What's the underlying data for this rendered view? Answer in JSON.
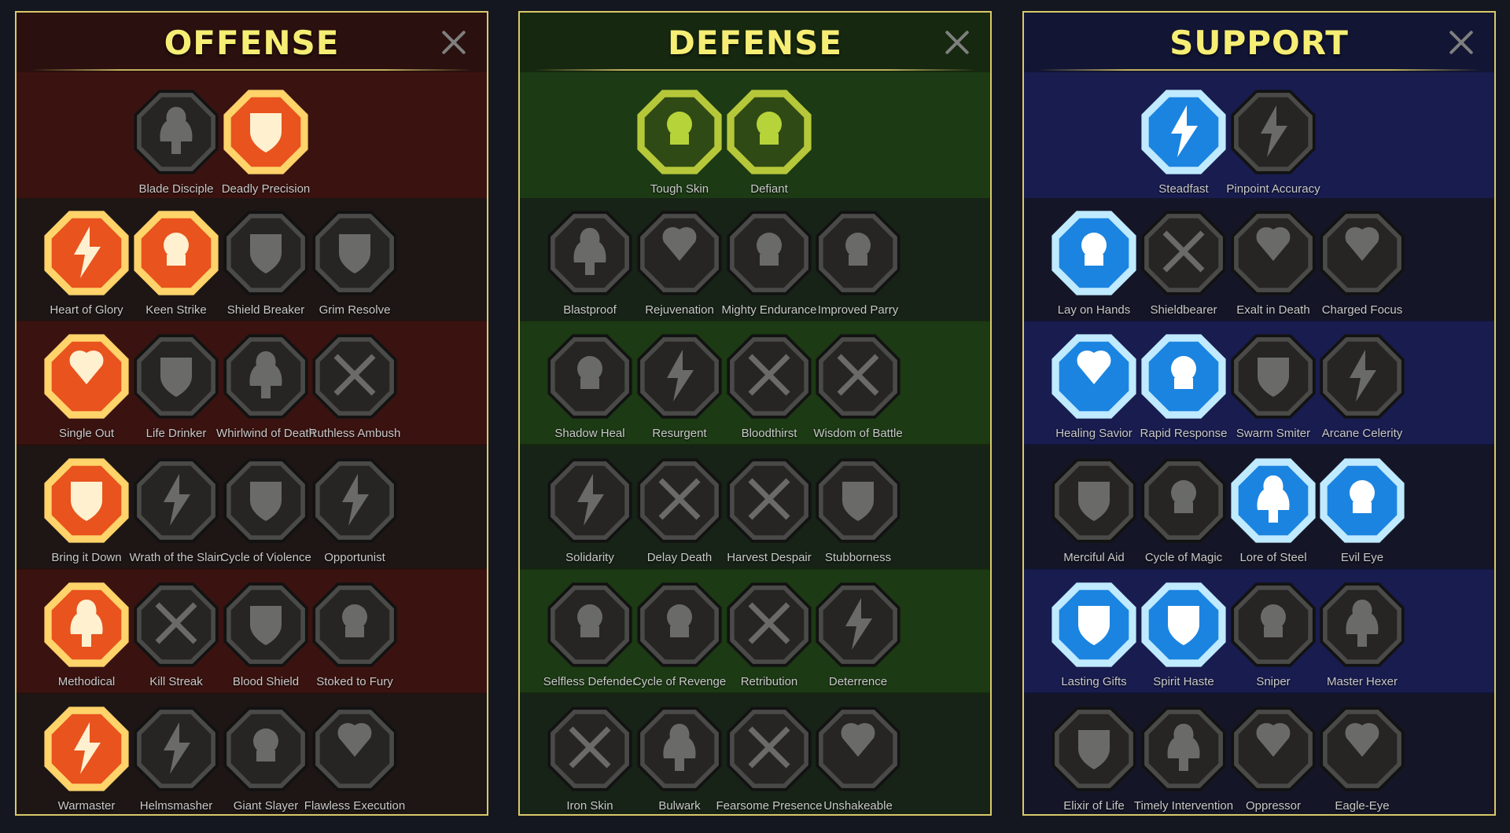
{
  "panels": [
    {
      "id": "offense",
      "title": "OFFENSE",
      "colors": {
        "active_fill": "#e8531e",
        "active_ring": "#ffd36a",
        "active_glyph": "#fff0d0"
      },
      "rows": [
        [
          {
            "label": "Blade Disciple",
            "icon": "crossed-swords-icon",
            "active": false,
            "col": 1
          },
          {
            "label": "Deadly Precision",
            "icon": "dagger-strike-icon",
            "active": true,
            "col": 2
          }
        ],
        [
          {
            "label": "Heart of Glory",
            "icon": "horned-heart-icon",
            "active": true
          },
          {
            "label": "Keen Strike",
            "icon": "sword-slash-icon",
            "active": true
          },
          {
            "label": "Shield Breaker",
            "icon": "broken-shield-icon",
            "active": false
          },
          {
            "label": "Grim Resolve",
            "icon": "dark-heart-icon",
            "active": false
          }
        ],
        [
          {
            "label": "Single Out",
            "icon": "arrows-target-icon",
            "active": true
          },
          {
            "label": "Life Drinker",
            "icon": "fangs-icon",
            "active": false
          },
          {
            "label": "Whirlwind of Death",
            "icon": "skull-whirl-icon",
            "active": false
          },
          {
            "label": "Ruthless Ambush",
            "icon": "hand-blade-icon",
            "active": false
          }
        ],
        [
          {
            "label": "Bring it Down",
            "icon": "bleeding-heart-sword-icon",
            "active": true
          },
          {
            "label": "Wrath of the Slain",
            "icon": "fist-blade-icon",
            "active": false
          },
          {
            "label": "Cycle of Violence",
            "icon": "axe-cycle-icon",
            "active": false
          },
          {
            "label": "Opportunist",
            "icon": "chains-lightning-icon",
            "active": false
          }
        ],
        [
          {
            "label": "Methodical",
            "icon": "arrows-hit-icon",
            "active": true
          },
          {
            "label": "Kill Streak",
            "icon": "triple-skull-icon",
            "active": false
          },
          {
            "label": "Blood Shield",
            "icon": "sword-shield-icon",
            "active": false
          },
          {
            "label": "Stoked to Fury",
            "icon": "raging-figure-icon",
            "active": false
          }
        ],
        [
          {
            "label": "Warmaster",
            "icon": "sword-stars-icon",
            "active": true
          },
          {
            "label": "Helmsmasher",
            "icon": "helmet-icon",
            "active": false
          },
          {
            "label": "Giant Slayer",
            "icon": "giant-icon",
            "active": false
          },
          {
            "label": "Flawless Execution",
            "icon": "skull-sunburst-icon",
            "active": false
          }
        ]
      ]
    },
    {
      "id": "defense",
      "title": "DEFENSE",
      "colors": {
        "active_fill": "#2f4a14",
        "active_ring": "#b6c83a",
        "active_glyph": "#b7d33a"
      },
      "rows": [
        [
          {
            "label": "Tough Skin",
            "icon": "armor-plates-icon",
            "active": true,
            "col": 1
          },
          {
            "label": "Defiant",
            "icon": "raised-fist-icon",
            "active": true,
            "col": 2
          }
        ],
        [
          {
            "label": "Blastproof",
            "icon": "chest-plate-icon",
            "active": false
          },
          {
            "label": "Rejuvenation",
            "icon": "anatomical-heart-icon",
            "active": false
          },
          {
            "label": "Mighty Endurance",
            "icon": "armored-warrior-icon",
            "active": false
          },
          {
            "label": "Improved Parry",
            "icon": "crossed-blades-icon",
            "active": false
          }
        ],
        [
          {
            "label": "Shadow Heal",
            "icon": "shadow-figure-icon",
            "active": false
          },
          {
            "label": "Resurgent",
            "icon": "knight-shield-icon",
            "active": false
          },
          {
            "label": "Bloodthirst",
            "icon": "skull-heart-icon",
            "active": false
          },
          {
            "label": "Wisdom of Battle",
            "icon": "hooded-sage-icon",
            "active": false
          }
        ],
        [
          {
            "label": "Solidarity",
            "icon": "group-icon",
            "active": false
          },
          {
            "label": "Delay Death",
            "icon": "hourglass-icon",
            "active": false
          },
          {
            "label": "Harvest Despair",
            "icon": "open-hand-icon",
            "active": false
          },
          {
            "label": "Stubborness",
            "icon": "bull-icon",
            "active": false
          }
        ],
        [
          {
            "label": "Selfless Defender",
            "icon": "running-shield-icon",
            "active": false
          },
          {
            "label": "Cycle of Revenge",
            "icon": "drops-cycle-icon",
            "active": false
          },
          {
            "label": "Retribution",
            "icon": "spiked-skull-icon",
            "active": false
          },
          {
            "label": "Deterrence",
            "icon": "deflect-hand-icon",
            "active": false
          }
        ],
        [
          {
            "label": "Iron Skin",
            "icon": "crowned-face-icon",
            "active": false
          },
          {
            "label": "Bulwark",
            "icon": "winged-shield-icon",
            "active": false
          },
          {
            "label": "Fearsome Presence",
            "icon": "fearsome-skull-icon",
            "active": false
          },
          {
            "label": "Unshakeable",
            "icon": "flexing-figure-icon",
            "active": false
          }
        ]
      ]
    },
    {
      "id": "support",
      "title": "SUPPORT",
      "colors": {
        "active_fill": "#1b84e0",
        "active_ring": "#bfeaff",
        "active_glyph": "#ffffff"
      },
      "rows": [
        [
          {
            "label": "Steadfast",
            "icon": "heart-plus-icon",
            "active": true,
            "col": 1
          },
          {
            "label": "Pinpoint Accuracy",
            "icon": "swirl-target-icon",
            "active": false,
            "col": 2
          }
        ],
        [
          {
            "label": "Lay on Hands",
            "icon": "praying-hands-icon",
            "active": true
          },
          {
            "label": "Shieldbearer",
            "icon": "shield-ring-icon",
            "active": false
          },
          {
            "label": "Exalt in Death",
            "icon": "flaming-skull-icon",
            "active": false
          },
          {
            "label": "Charged Focus",
            "icon": "blast-hand-icon",
            "active": false
          }
        ],
        [
          {
            "label": "Healing Savior",
            "icon": "healer-figure-icon",
            "active": true
          },
          {
            "label": "Rapid Response",
            "icon": "lightning-cycle-icon",
            "active": true
          },
          {
            "label": "Swarm Smiter",
            "icon": "zigzag-bolts-icon",
            "active": false
          },
          {
            "label": "Arcane Celerity",
            "icon": "shadow-runner-icon",
            "active": false
          }
        ],
        [
          {
            "label": "Merciful Aid",
            "icon": "chained-heart-icon",
            "active": false
          },
          {
            "label": "Cycle of Magic",
            "icon": "magic-orb-icon",
            "active": false
          },
          {
            "label": "Lore of Steel",
            "icon": "open-book-icon",
            "active": true
          },
          {
            "label": "Evil Eye",
            "icon": "evil-eyes-icon",
            "active": true
          }
        ],
        [
          {
            "label": "Lasting Gifts",
            "icon": "compass-star-icon",
            "active": true
          },
          {
            "label": "Spirit Haste",
            "icon": "winged-boot-icon",
            "active": true
          },
          {
            "label": "Sniper",
            "icon": "eye-icon",
            "active": false
          },
          {
            "label": "Master Hexer",
            "icon": "voodoo-doll-icon",
            "active": false
          }
        ],
        [
          {
            "label": "Elixir of Life",
            "icon": "potion-flask-icon",
            "active": false
          },
          {
            "label": "Timely Intervention",
            "icon": "winged-skull-icon",
            "active": false
          },
          {
            "label": "Oppressor",
            "icon": "crushing-fist-icon",
            "active": false
          },
          {
            "label": "Eagle-Eye",
            "icon": "eagle-icon",
            "active": false
          }
        ]
      ]
    }
  ]
}
